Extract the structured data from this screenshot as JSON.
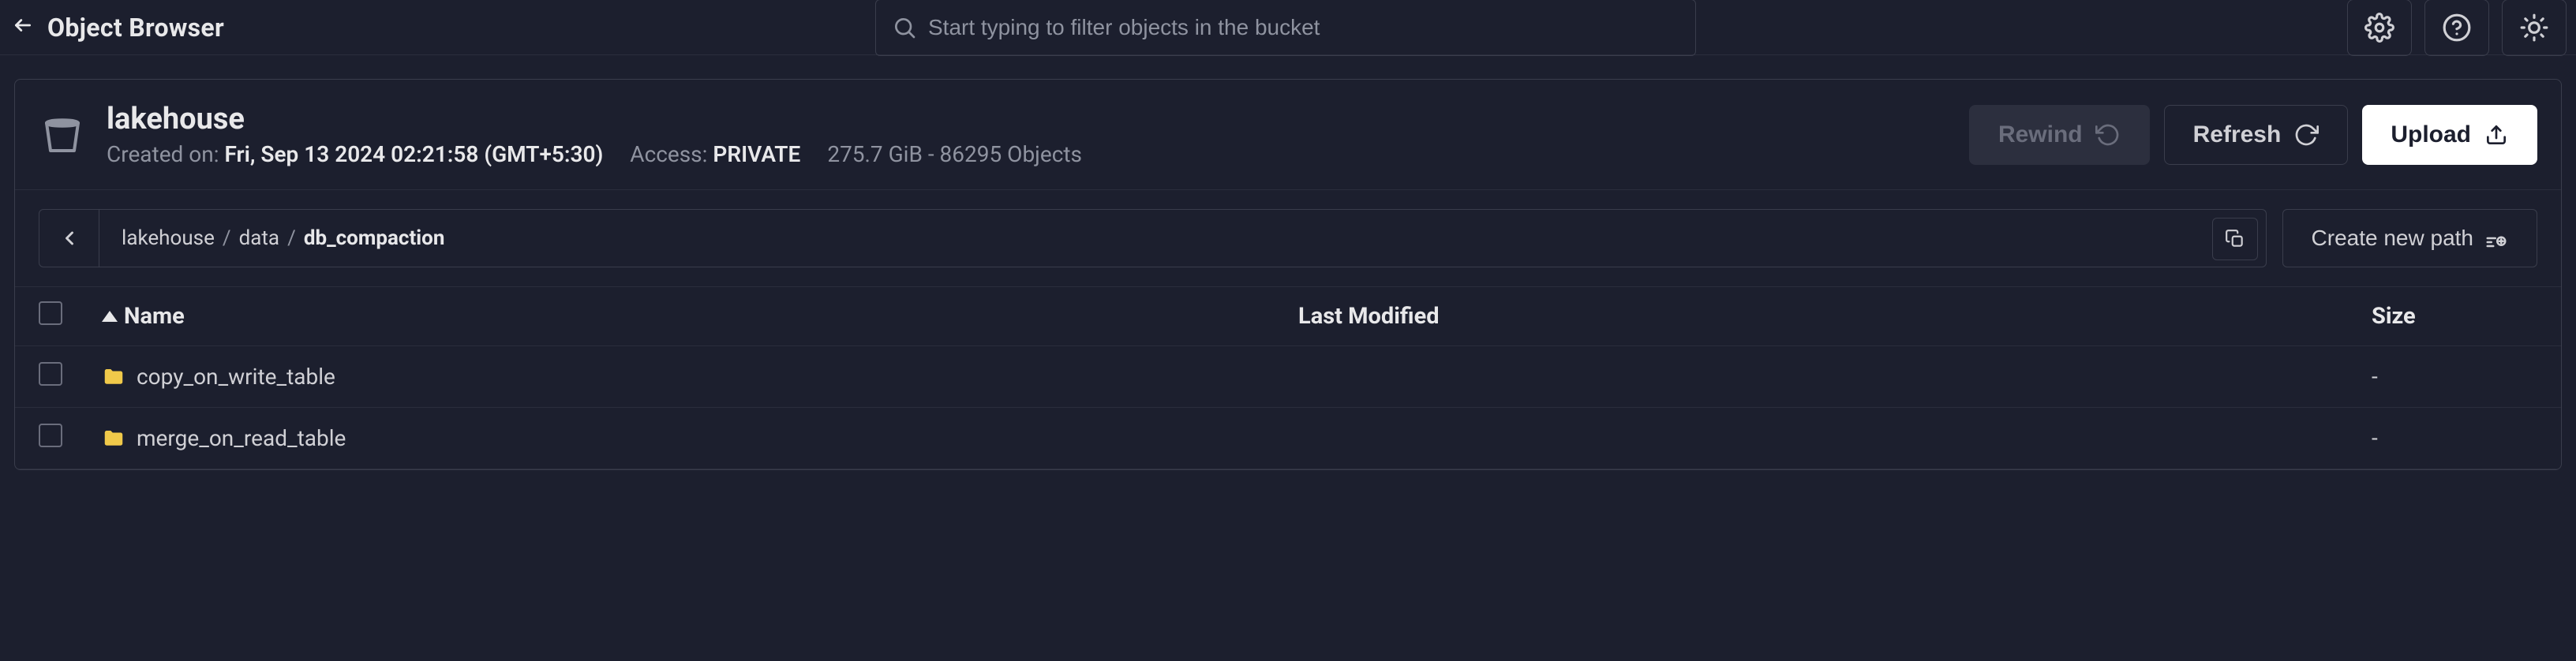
{
  "header": {
    "title": "Object Browser",
    "search_placeholder": "Start typing to filter objects in the bucket"
  },
  "bucket": {
    "name": "lakehouse",
    "created_label": "Created on:",
    "created_value": "Fri, Sep 13 2024 02:21:58 (GMT+5:30)",
    "access_label": "Access:",
    "access_value": "PRIVATE",
    "stats": "275.7 GiB - 86295 Objects",
    "actions": {
      "rewind": "Rewind",
      "refresh": "Refresh",
      "upload": "Upload"
    }
  },
  "breadcrumb": {
    "segments": [
      "lakehouse",
      "data",
      "db_compaction"
    ],
    "create_path_label": "Create new path"
  },
  "table": {
    "columns": {
      "name": "Name",
      "modified": "Last Modified",
      "size": "Size"
    },
    "rows": [
      {
        "name": "copy_on_write_table",
        "modified": "",
        "size": "-"
      },
      {
        "name": "merge_on_read_table",
        "modified": "",
        "size": "-"
      }
    ]
  },
  "colors": {
    "folder": "#f0c94a"
  }
}
